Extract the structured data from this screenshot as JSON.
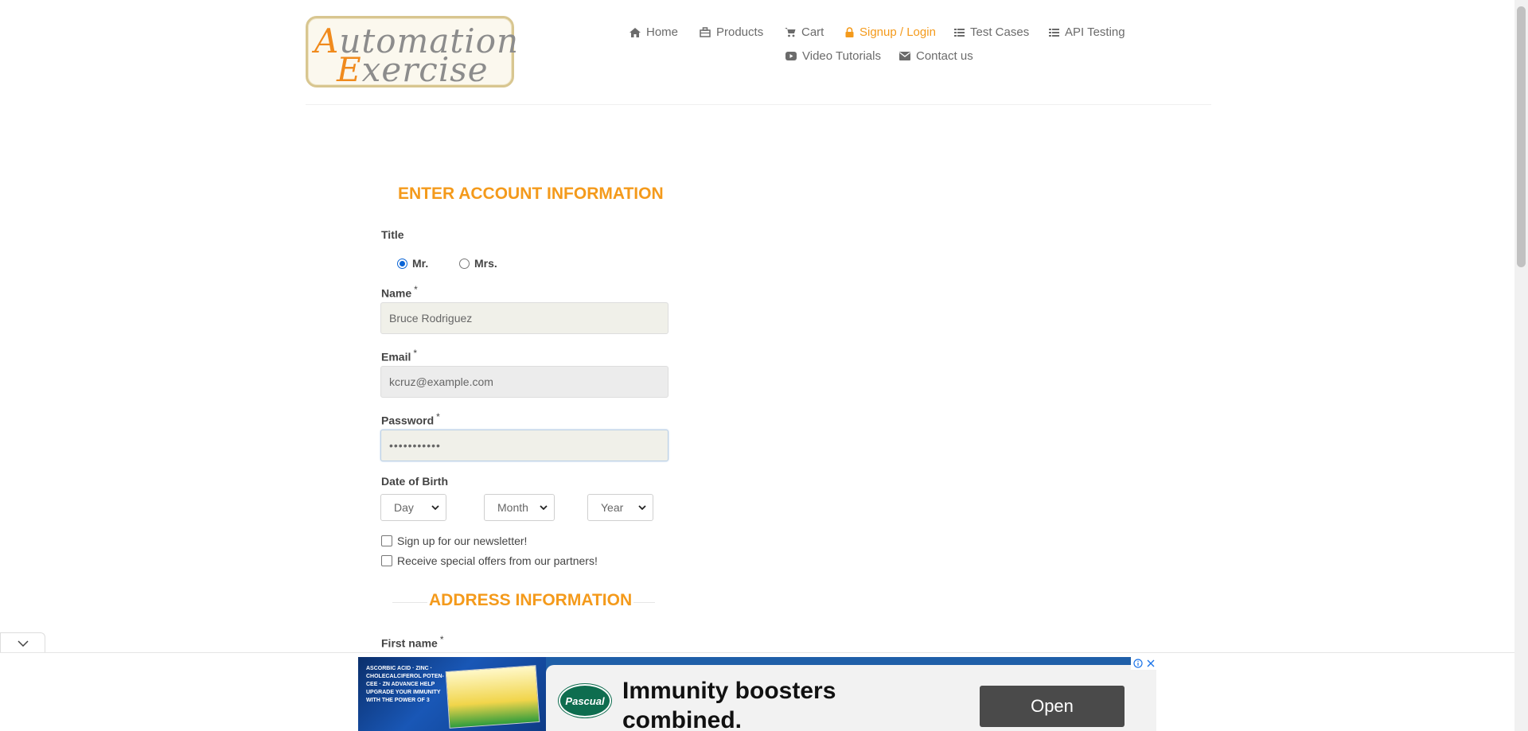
{
  "header": {
    "logo": {
      "line1_cap": "A",
      "line1_rest": "utomation",
      "line2_cap": "E",
      "line2_rest": "xercise"
    },
    "nav": [
      {
        "label": "Home",
        "icon": "home-icon"
      },
      {
        "label": "Products",
        "icon": "products-icon"
      },
      {
        "label": "Cart",
        "icon": "cart-icon"
      },
      {
        "label": "Signup / Login",
        "icon": "lock-icon",
        "active": true
      },
      {
        "label": "Test Cases",
        "icon": "list-icon"
      },
      {
        "label": "API Testing",
        "icon": "list-icon"
      },
      {
        "label": "Video Tutorials",
        "icon": "youtube-play-icon"
      },
      {
        "label": "Contact us",
        "icon": "envelope-icon"
      }
    ]
  },
  "form": {
    "title": "ENTER ACCOUNT INFORMATION",
    "title_label": "Title",
    "title_options": [
      {
        "label": "Mr.",
        "selected": true
      },
      {
        "label": "Mrs.",
        "selected": false
      }
    ],
    "name_label": "Name",
    "name_value": "Bruce Rodriguez",
    "email_label": "Email",
    "email_value": "kcruz@example.com",
    "password_label": "Password",
    "password_value": "•••••••••••",
    "required_mark": "*",
    "dob_label": "Date of Birth",
    "dob_day": "Day",
    "dob_month": "Month",
    "dob_year": "Year",
    "newsletter_label": "Sign up for our newsletter!",
    "offers_label": "Receive special offers from our partners!",
    "address_title": "ADDRESS INFORMATION",
    "first_name_label": "First name"
  },
  "ad": {
    "left_text": "ASCORBIC ACID · ZINC · CHOLECALCIFEROL POTEN-CEE · ZN ADVANCE HELP UPGRADE YOUR IMMUNITY WITH THE POWER OF 3",
    "brand": "Pascual",
    "headline_1": "Immunity boosters",
    "headline_2": "combined.",
    "cta": "Open"
  },
  "colors": {
    "accent": "#f49a1b",
    "text": "#444444",
    "nav": "#6b6b6b"
  }
}
